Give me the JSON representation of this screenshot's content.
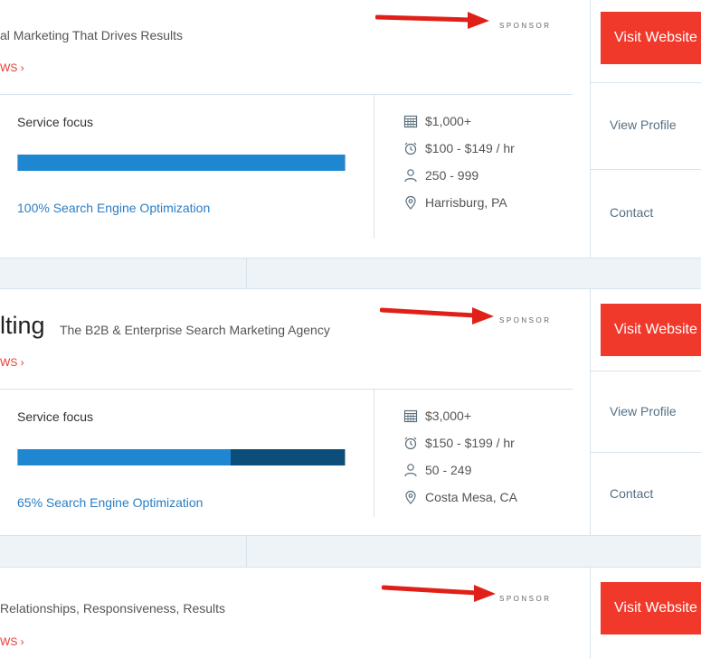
{
  "listings": [
    {
      "name_fragment": "",
      "tagline": "al Marketing That Drives Results",
      "reviews_link": "WS ›",
      "sponsor_label": "SPONSOR",
      "service_focus_label": "Service focus",
      "focus_percent": 100,
      "focus_text": "100%  Search Engine Optimization",
      "min_project": "$1,000+",
      "hourly_rate": "$100 - $149 / hr",
      "employees": "250 - 999",
      "location": "Harrisburg, PA",
      "visit_label": "Visit Website",
      "view_profile_label": "View Profile",
      "contact_label": "Contact"
    },
    {
      "name_fragment": "lting",
      "tagline": "The B2B & Enterprise Search Marketing Agency",
      "reviews_link": "WS ›",
      "sponsor_label": "SPONSOR",
      "service_focus_label": "Service focus",
      "focus_percent": 65,
      "focus_text": "65%  Search Engine Optimization",
      "min_project": "$3,000+",
      "hourly_rate": "$150 - $199 / hr",
      "employees": "50 - 249",
      "location": "Costa Mesa, CA",
      "visit_label": "Visit Website",
      "view_profile_label": "View Profile",
      "contact_label": "Contact"
    },
    {
      "name_fragment": "",
      "tagline": "Relationships, Responsiveness, Results",
      "reviews_link": "WS ›",
      "sponsor_label": "SPONSOR",
      "visit_label": "Visit Website"
    }
  ],
  "colors": {
    "accent_red": "#f0392b",
    "focus_primary": "#1f87d2",
    "focus_secondary": "#0b4e7a",
    "link_blue": "#2a7ec4"
  },
  "icons": [
    "calendar-icon",
    "alarm-clock-icon",
    "person-icon",
    "location-pin-icon",
    "red-arrow-annotation"
  ]
}
